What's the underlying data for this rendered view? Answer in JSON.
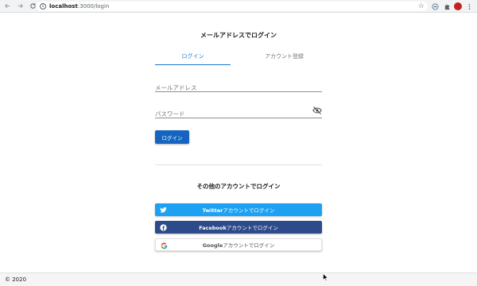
{
  "browser": {
    "url_host": "localhost",
    "url_path": ":3000/login"
  },
  "page": {
    "title": "メールアドレスでログイン",
    "tabs": [
      {
        "label": "ログイン",
        "active": true
      },
      {
        "label": "アカウント登録",
        "active": false
      }
    ],
    "email_placeholder": "メールアドレス",
    "password_placeholder": "パスワード",
    "login_button": "ログイン",
    "other_title": "その他のアカウントでログイン",
    "social": {
      "twitter": {
        "brand": "Twitter",
        "suffix": "アカウントでログイン",
        "color": "#1da1f2"
      },
      "facebook": {
        "brand": "Facebook",
        "suffix": "アカウントでログイン",
        "color": "#2d4a8a"
      },
      "google": {
        "brand": "Google",
        "suffix": "アカウントでログイン",
        "color": "#ffffff"
      }
    }
  },
  "footer": {
    "text": "© 2020"
  },
  "colors": {
    "primary": "#1565c0",
    "tab_active": "#1976d2"
  }
}
